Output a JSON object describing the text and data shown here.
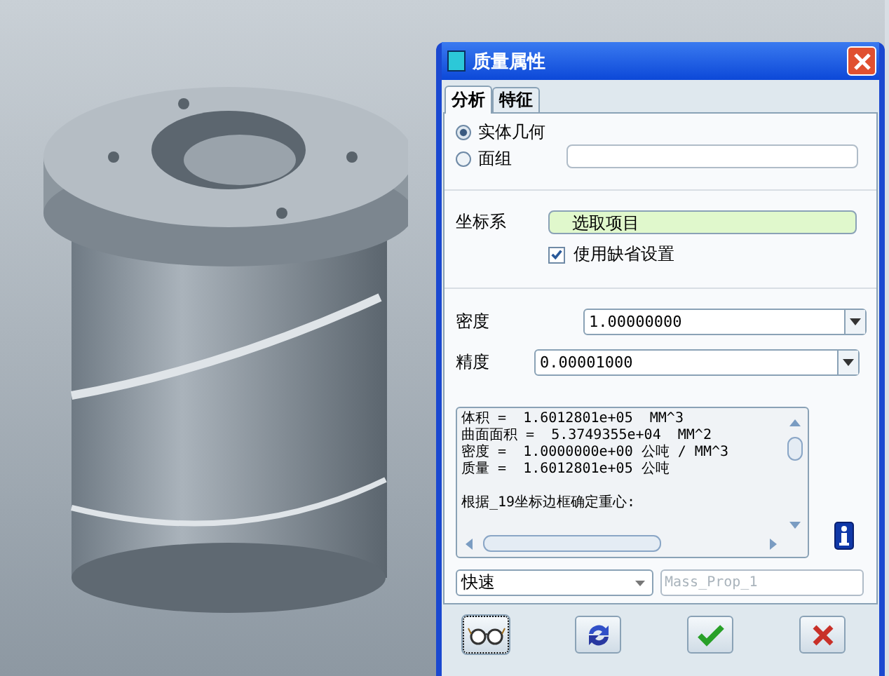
{
  "dialog": {
    "title": "质量属性"
  },
  "tabs": [
    {
      "label": "分析",
      "selected": true
    },
    {
      "label": "特征",
      "selected": false
    }
  ],
  "geometry_options": [
    {
      "label": "实体几何",
      "selected": true
    },
    {
      "label": "面组",
      "selected": false
    }
  ],
  "coordinate_system": {
    "label": "坐标系",
    "value": "选取项目"
  },
  "use_default": {
    "label": "使用缺省设置",
    "checked": true
  },
  "density": {
    "label": "密度",
    "value": "1.00000000"
  },
  "precision": {
    "label": "精度",
    "value": "0.00001000"
  },
  "results": {
    "lines": [
      "体积 =  1.6012801e+05  MM^3",
      "曲面面积 =  5.3749355e+04  MM^2",
      "密度 =  1.0000000e+00 公吨 / MM^3",
      "质量 =  1.6012801e+05 公吨"
    ],
    "note": "根据_19坐标边框确定重心:"
  },
  "mode_dropdown": {
    "value": "快速"
  },
  "name_field": {
    "placeholder": "Mass_Prop_1"
  }
}
